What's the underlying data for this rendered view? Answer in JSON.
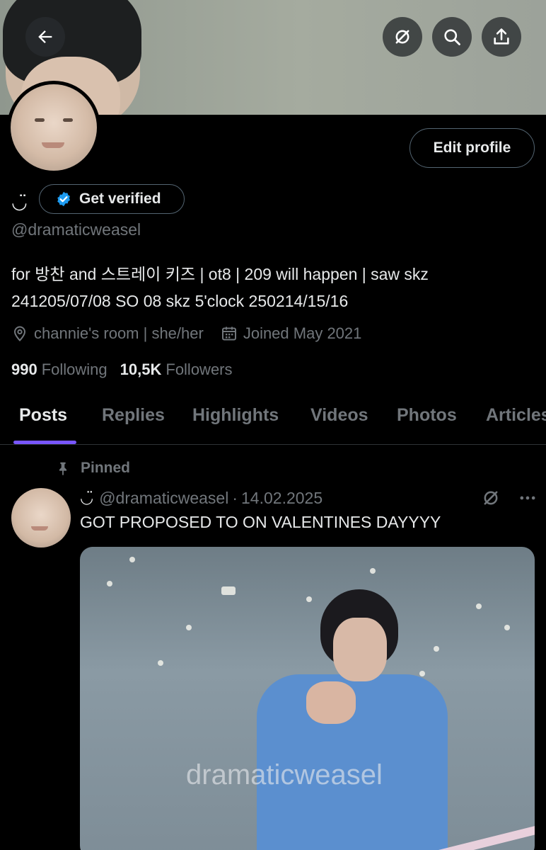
{
  "header": {
    "back_icon": "arrow-left-icon",
    "grok_icon": "grok-icon",
    "search_icon": "search-icon",
    "share_icon": "share-icon"
  },
  "profile": {
    "edit_label": "Edit profile",
    "name_glyph": "◡̈",
    "verify_label": "Get verified",
    "handle": "@dramaticweasel",
    "bio_line1": "for 방찬 and 스트레이 키즈 | ot8 | 209 will happen | saw skz",
    "bio_line2": "241205/07/08 SO 08 skz 5'clock 250214/15/16",
    "location": "channie's room | she/her",
    "joined": "Joined May 2021",
    "following_count": "990",
    "following_label": "Following",
    "followers_count": "10,5K",
    "followers_label": "Followers"
  },
  "tabs": [
    "Posts",
    "Replies",
    "Highlights",
    "Videos",
    "Photos",
    "Articles"
  ],
  "post": {
    "pinned_label": "Pinned",
    "author_glyph": "◡̈",
    "author_handle": "@dramaticweasel",
    "separator": "·",
    "date": "14.02.2025",
    "text": "GOT PROPOSED TO ON VALENTINES DAYYYY",
    "media_watermark": "dramaticweasel"
  },
  "colors": {
    "background": "#000000",
    "text_primary": "#e7e9ea",
    "text_secondary": "#71767b",
    "border": "#2f3336",
    "verified_blue": "#1d9bf0",
    "tab_indicator": "#7856ff"
  }
}
